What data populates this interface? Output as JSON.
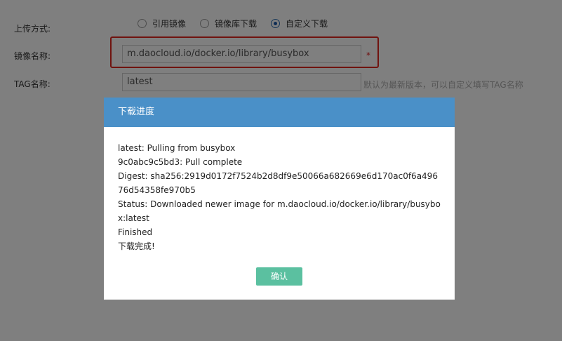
{
  "form": {
    "upload_method_label": "上传方式:",
    "image_name_label": "镜像名称:",
    "tag_name_label": "TAG名称:",
    "radio_options": [
      {
        "label": "引用镜像",
        "checked": false
      },
      {
        "label": "镜像库下载",
        "checked": false
      },
      {
        "label": "自定义下载",
        "checked": true
      }
    ],
    "image_name_value": "m.daocloud.io/docker.io/library/busybox",
    "required_mark": "*",
    "tag_value": "latest",
    "tag_hint": "默认为最新版本，可以自定义填写TAG名称"
  },
  "modal": {
    "title": "下载进度",
    "log_lines": [
      "latest: Pulling from busybox",
      "9c0abc9c5bd3: Pull complete",
      "Digest: sha256:2919d0172f7524b2d8df9e50066a682669e6d170ac0f6a49676d54358fe970b5",
      "Status: Downloaded newer image for m.daocloud.io/docker.io/library/busybox:latest",
      "Finished",
      "下载完成!"
    ],
    "confirm_label": "确认"
  },
  "colors": {
    "header_bg": "#4a90c8",
    "confirm_bg": "#5bc0a0",
    "highlight_border": "#e0261f"
  }
}
